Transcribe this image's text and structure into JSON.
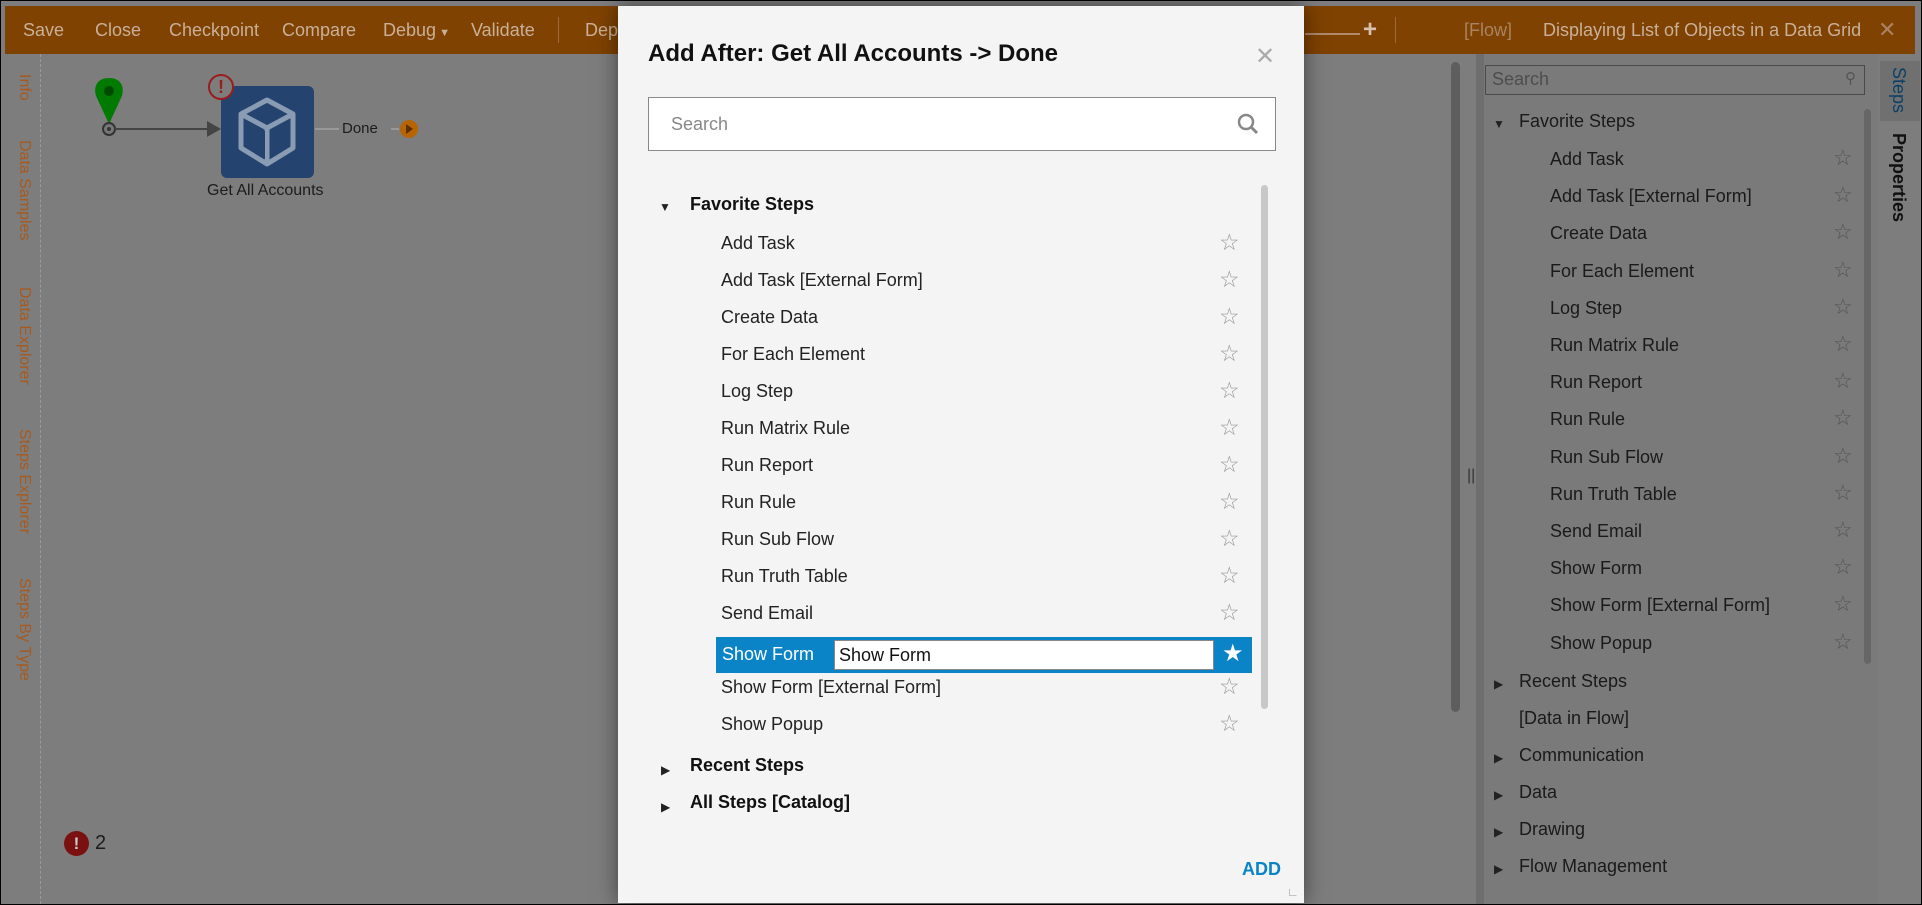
{
  "toolbar": {
    "items": [
      "Save",
      "Close",
      "Checkpoint",
      "Compare",
      "Debug",
      "Validate",
      "Dep"
    ],
    "flow_tag": "[Flow]",
    "title": "Displaying List of Objects in a Data Grid",
    "close_icon": "close-icon",
    "zoom_plus": "+"
  },
  "left_tabs": [
    "Info",
    "Data Samples",
    "Data Explorer",
    "Steps Explorer",
    "Steps By Type"
  ],
  "canvas": {
    "node_label": "Get All Accounts",
    "outcome": "Done",
    "error_count": "2"
  },
  "right_panel": {
    "search_placeholder": "Search",
    "favorites_header": "Favorite Steps",
    "favorites": [
      "Add Task",
      "Add Task [External Form]",
      "Create Data",
      "For Each Element",
      "Log Step",
      "Run Matrix Rule",
      "Run Report",
      "Run Rule",
      "Run Sub Flow",
      "Run Truth Table",
      "Send Email",
      "Show Form",
      "Show Form [External Form]",
      "Show Popup"
    ],
    "recent": "Recent Steps",
    "data_in_flow": "[Data in Flow]",
    "categories": [
      "Communication",
      "Data",
      "Drawing",
      "Flow Management"
    ],
    "tabs": [
      "Steps",
      "Properties"
    ]
  },
  "modal": {
    "title": "Add After: Get All Accounts -> Done",
    "search_placeholder": "Search",
    "favorites_header": "Favorite Steps",
    "favorites": [
      "Add Task",
      "Add Task [External Form]",
      "Create Data",
      "For Each Element",
      "Log Step",
      "Run Matrix Rule",
      "Run Report",
      "Run Rule",
      "Run Sub Flow",
      "Run Truth Table",
      "Send Email",
      "Show Form",
      "Show Form [External Form]",
      "Show Popup"
    ],
    "selected": "Show Form",
    "selected_edit_value": "Show Form",
    "recent": "Recent Steps",
    "all_steps": "All Steps [Catalog]",
    "add_label": "ADD",
    "accent": "#0a84c6"
  }
}
